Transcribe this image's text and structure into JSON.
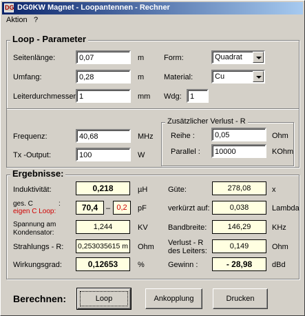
{
  "window": {
    "title": "DG0KW  Magnet - Loopantennen - Rechner",
    "app_icon_text": "DG"
  },
  "menu": [
    {
      "label": "Aktion"
    },
    {
      "label": "?"
    }
  ],
  "loop_group": {
    "title": "Loop - Parameter",
    "seitenlaenge": {
      "label": "Seitenlänge:",
      "value": "0,07",
      "unit": "m"
    },
    "umfang": {
      "label": "Umfang:",
      "value": "0,28",
      "unit": "m"
    },
    "leiter": {
      "label": "Leiterdurchmesser:",
      "value": "1",
      "unit": "mm"
    },
    "form": {
      "label": "Form:",
      "value": "Quadrat"
    },
    "material": {
      "label": "Material:",
      "value": "Cu"
    },
    "wdg": {
      "label": "Wdg:",
      "value": "1"
    },
    "frequenz": {
      "label": "Frequenz:",
      "value": "40,68",
      "unit": "MHz"
    },
    "tx_output": {
      "label": "Tx -Output:",
      "value": "100",
      "unit": "W"
    }
  },
  "verlust_group": {
    "title": "Zusätzlicher Verlust - R",
    "reihe": {
      "label": "Reihe :",
      "value": "0,05",
      "unit": "Ohm"
    },
    "parallel": {
      "label": "Parallel :",
      "value": "10000",
      "unit": "KOhm"
    }
  },
  "results": {
    "title": "Ergebnisse:",
    "induktivitaet": {
      "label": "Induktivität:",
      "value": "0,218",
      "unit": "µH"
    },
    "kapazitaet": {
      "label1": "ges.   C",
      "label2": "eigen C  Loop:",
      "colon": ":",
      "value": "70,4",
      "dash": "–",
      "eigen_value": "0,2",
      "unit": "pF"
    },
    "spannung": {
      "label1": "Spannung am",
      "label2": "Kondensator:",
      "value": "1,244",
      "unit": "KV"
    },
    "strahlung": {
      "label": "Strahlungs - R:",
      "value": "0,253035615 m",
      "unit": "Ohm"
    },
    "wirkungsgrad": {
      "label": "Wirkungsgrad:",
      "value": "0,12653",
      "unit": "%"
    },
    "guete": {
      "label": "Güte:",
      "value": "278,08",
      "unit": "x"
    },
    "verkuerzt": {
      "label": "verkürzt auf:",
      "value": "0,038",
      "unit": "Lambda"
    },
    "bandbreite": {
      "label": "Bandbreite:",
      "value": "146,29",
      "unit": "KHz"
    },
    "verlust_leiter": {
      "label1": "Verlust - R",
      "label2": "des Leiters:",
      "value": "0,149",
      "unit": "Ohm"
    },
    "gewinn": {
      "label": "Gewinn :",
      "value": "- 28,98",
      "unit": "dBd"
    }
  },
  "actions": {
    "label": "Berechnen:",
    "loop": "Loop",
    "ankopplung": "Ankopplung",
    "drucken": "Drucken"
  }
}
